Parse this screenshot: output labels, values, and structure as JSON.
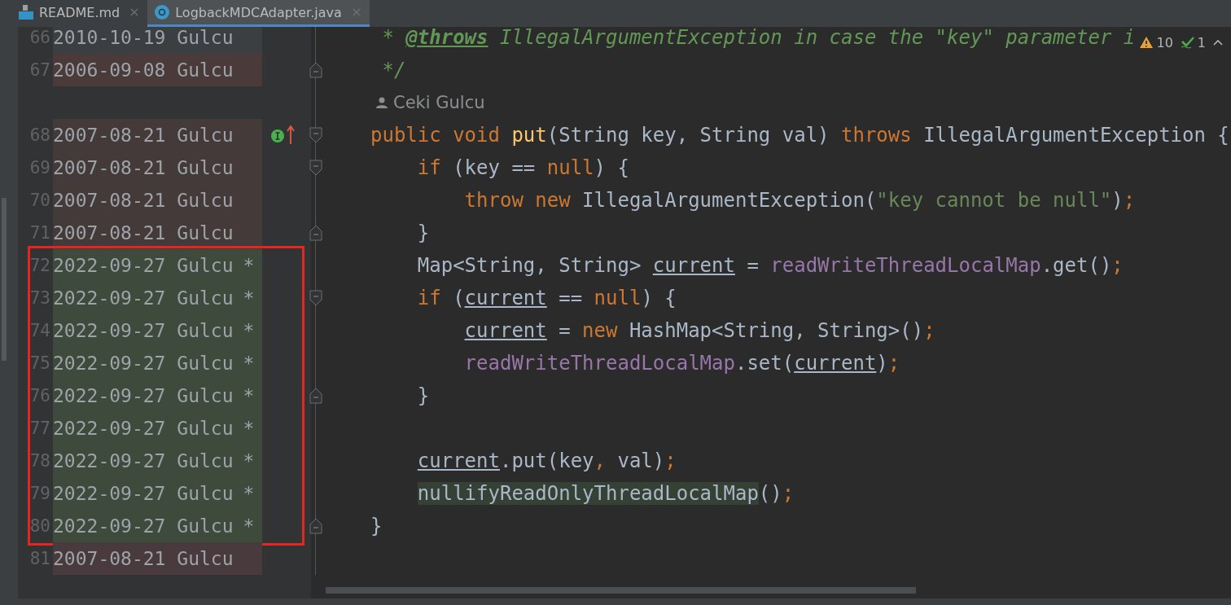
{
  "tabs": [
    {
      "label": "README.md",
      "kind": "md",
      "selected": false
    },
    {
      "label": "LogbackMDCAdapter.java",
      "kind": "class",
      "selected": true
    }
  ],
  "inspections": {
    "warnings": "10",
    "checks": "1"
  },
  "rows": [
    {
      "kind": "line",
      "number": "66",
      "date": "2010-10-19",
      "author": "Gulcu",
      "color": "#3c3f41",
      "tokens": [
        {
          "kind": "comment",
          "text": " * "
        },
        {
          "kind": "doctag",
          "text": "@throws"
        },
        {
          "kind": "comment",
          "text": " IllegalArgumentException in case the \"key\" parameter i"
        }
      ]
    },
    {
      "kind": "line",
      "number": "67",
      "date": "2006-09-08",
      "author": "Gulcu",
      "color": "#4a3a3a",
      "fold_close": true,
      "tokens": [
        {
          "kind": "comment",
          "text": " */"
        }
      ]
    },
    {
      "kind": "inlay",
      "author": "Ceki Gulcu"
    },
    {
      "kind": "line",
      "number": "68",
      "date": "2007-08-21",
      "author": "Gulcu",
      "color": "#453a3a",
      "fold_open": true,
      "gutter_marker": true,
      "tokens": [
        {
          "kind": "kw",
          "text": "public void "
        },
        {
          "kind": "fn",
          "text": "put"
        },
        {
          "kind": "plain",
          "text": "(String key, String val) "
        },
        {
          "kind": "kw",
          "text": "throws"
        },
        {
          "kind": "plain",
          "text": " IllegalArgumentException {"
        }
      ]
    },
    {
      "kind": "line",
      "number": "69",
      "date": "2007-08-21",
      "author": "Gulcu",
      "color": "#453a3a",
      "fold_open": true,
      "tokens": [
        {
          "kind": "kw",
          "text": "    if"
        },
        {
          "kind": "plain",
          "text": " (key == "
        },
        {
          "kind": "kw",
          "text": "null"
        },
        {
          "kind": "plain",
          "text": ") {"
        }
      ]
    },
    {
      "kind": "line",
      "number": "70",
      "date": "2007-08-21",
      "author": "Gulcu",
      "color": "#453a3a",
      "tokens": [
        {
          "kind": "kw",
          "text": "        throw new"
        },
        {
          "kind": "plain",
          "text": " IllegalArgumentException("
        },
        {
          "kind": "str",
          "text": "\"key cannot be null\""
        },
        {
          "kind": "plain",
          "text": ")"
        },
        {
          "kind": "kw",
          "text": ";"
        }
      ]
    },
    {
      "kind": "line",
      "number": "71",
      "date": "2007-08-21",
      "author": "Gulcu",
      "color": "#453a3a",
      "fold_close": true,
      "tokens": [
        {
          "kind": "plain",
          "text": "    }"
        }
      ]
    },
    {
      "kind": "line",
      "number": "72",
      "date": "2022-09-27",
      "author": "Gulcu",
      "mark": "*",
      "boxed": true,
      "color": "#3d4a3c",
      "tokens": [
        {
          "kind": "plain",
          "text": "    Map<String, String> "
        },
        {
          "kind": "var",
          "text": "current"
        },
        {
          "kind": "plain",
          "text": " = "
        },
        {
          "kind": "field",
          "text": "readWriteThreadLocalMap"
        },
        {
          "kind": "plain",
          "text": ".get()"
        },
        {
          "kind": "kw",
          "text": ";"
        }
      ]
    },
    {
      "kind": "line",
      "number": "73",
      "date": "2022-09-27",
      "author": "Gulcu",
      "mark": "*",
      "boxed": true,
      "color": "#3d4a3c",
      "fold_open": true,
      "tokens": [
        {
          "kind": "kw",
          "text": "    if"
        },
        {
          "kind": "plain",
          "text": " ("
        },
        {
          "kind": "var",
          "text": "current"
        },
        {
          "kind": "plain",
          "text": " == "
        },
        {
          "kind": "kw",
          "text": "null"
        },
        {
          "kind": "plain",
          "text": ") {"
        }
      ]
    },
    {
      "kind": "line",
      "number": "74",
      "date": "2022-09-27",
      "author": "Gulcu",
      "mark": "*",
      "boxed": true,
      "color": "#3d4a3c",
      "tokens": [
        {
          "kind": "var",
          "text": "        current"
        },
        {
          "kind": "plain",
          "text": " = "
        },
        {
          "kind": "kw",
          "text": "new"
        },
        {
          "kind": "plain",
          "text": " HashMap<String, String>()"
        },
        {
          "kind": "kw",
          "text": ";"
        }
      ]
    },
    {
      "kind": "line",
      "number": "75",
      "date": "2022-09-27",
      "author": "Gulcu",
      "mark": "*",
      "boxed": true,
      "color": "#3d4a3c",
      "tokens": [
        {
          "kind": "field",
          "text": "        readWriteThreadLocalMap"
        },
        {
          "kind": "plain",
          "text": ".set("
        },
        {
          "kind": "var",
          "text": "current"
        },
        {
          "kind": "plain",
          "text": ")"
        },
        {
          "kind": "kw",
          "text": ";"
        }
      ]
    },
    {
      "kind": "line",
      "number": "76",
      "date": "2022-09-27",
      "author": "Gulcu",
      "mark": "*",
      "boxed": true,
      "color": "#3d4a3c",
      "fold_close": true,
      "tokens": [
        {
          "kind": "plain",
          "text": "    }"
        }
      ]
    },
    {
      "kind": "line",
      "number": "77",
      "date": "2022-09-27",
      "author": "Gulcu",
      "mark": "*",
      "boxed": true,
      "color": "#3d4a3c",
      "tokens": []
    },
    {
      "kind": "line",
      "number": "78",
      "date": "2022-09-27",
      "author": "Gulcu",
      "mark": "*",
      "boxed": true,
      "color": "#3d4a3c",
      "tokens": [
        {
          "kind": "var",
          "text": "    current"
        },
        {
          "kind": "plain",
          "text": ".put(key"
        },
        {
          "kind": "kw",
          "text": ","
        },
        {
          "kind": "plain",
          "text": " val)"
        },
        {
          "kind": "kw",
          "text": ";"
        }
      ]
    },
    {
      "kind": "line",
      "number": "79",
      "date": "2022-09-27",
      "author": "Gulcu",
      "mark": "*",
      "boxed": true,
      "color": "#3d4a3c",
      "tokens": [
        {
          "kind": "hl",
          "text": "    nullifyReadOnlyThreadLocalMap"
        },
        {
          "kind": "plain",
          "text": "()"
        },
        {
          "kind": "kw",
          "text": ";"
        }
      ]
    },
    {
      "kind": "line",
      "number": "80",
      "date": "2022-09-27",
      "author": "Gulcu",
      "mark": "*",
      "boxed": true,
      "color": "#3d4a3c",
      "fold_close": true,
      "tokens": [
        {
          "kind": "plain",
          "text": "}"
        }
      ]
    },
    {
      "kind": "line",
      "number": "81",
      "date": "2007-08-21",
      "author": "Gulcu",
      "color": "#483a3d",
      "tokens": []
    }
  ]
}
